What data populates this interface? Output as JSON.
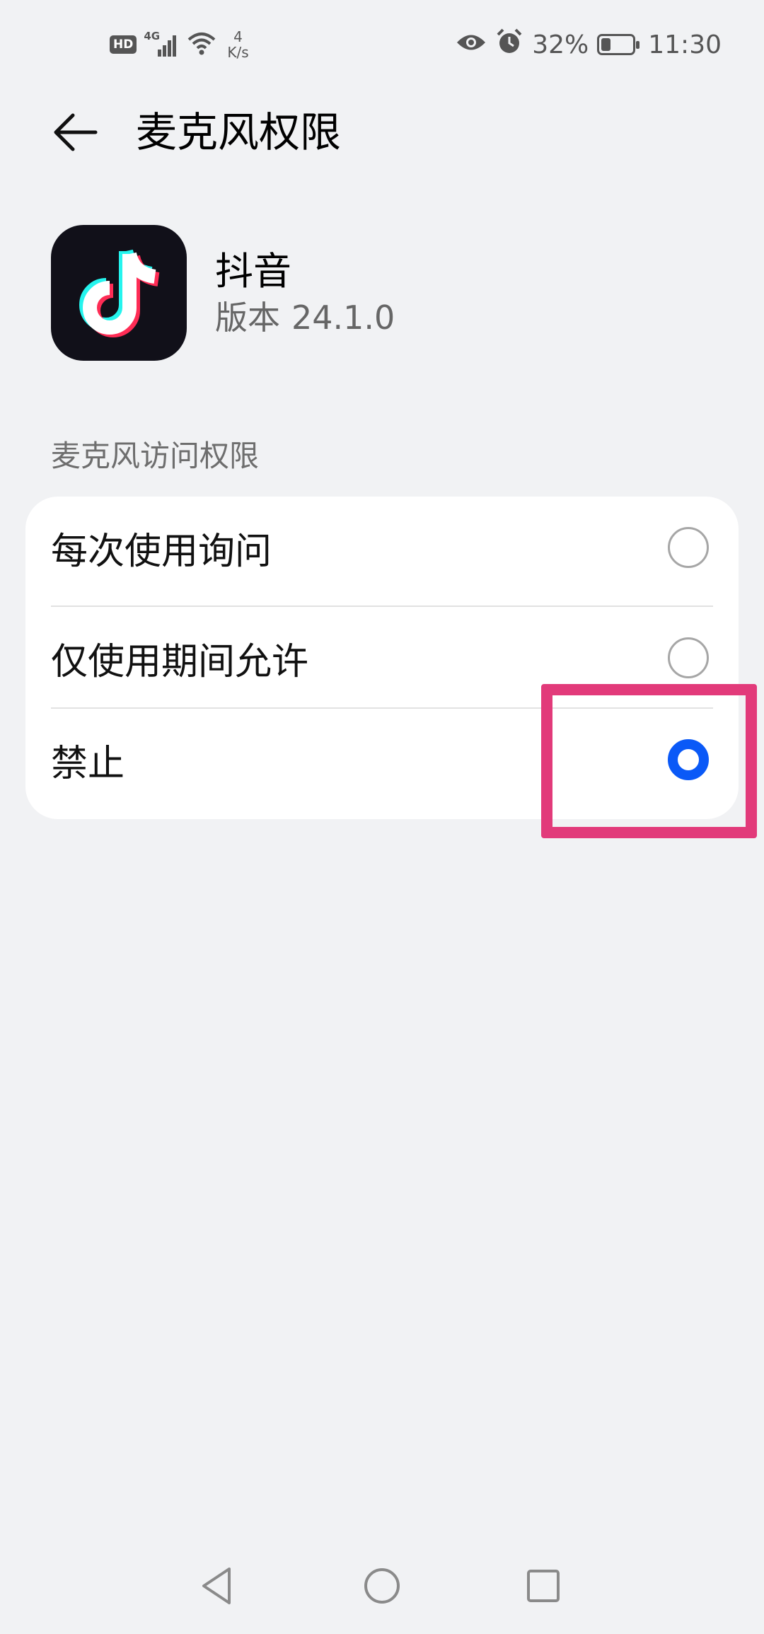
{
  "status_bar": {
    "hd_badge": "HD",
    "network": "4G",
    "net_rate_value": "4",
    "net_rate_unit": "K/s",
    "battery_percent": "32%",
    "battery_level": 0.32,
    "time": "11:30",
    "icons": [
      "hd-badge",
      "signal-icon",
      "wifi-icon",
      "eye-icon",
      "alarm-icon",
      "battery-icon"
    ]
  },
  "header": {
    "title": "麦克风权限",
    "back_icon": "arrow-left-icon"
  },
  "app": {
    "name": "抖音",
    "version_label": "版本",
    "version": "24.1.0",
    "icon": "douyin-logo-icon"
  },
  "section": {
    "label": "麦克风访问权限"
  },
  "options": [
    {
      "label": "每次使用询问",
      "selected": false
    },
    {
      "label": "仅使用期间允许",
      "selected": false
    },
    {
      "label": "禁止",
      "selected": true
    }
  ],
  "colors": {
    "accent": "#0a59f7",
    "highlight": "#e23a7a",
    "background": "#f1f2f4",
    "card": "#ffffff"
  },
  "nav_bar": {
    "icons": [
      "back-triangle-icon",
      "home-circle-icon",
      "recents-square-icon"
    ]
  }
}
